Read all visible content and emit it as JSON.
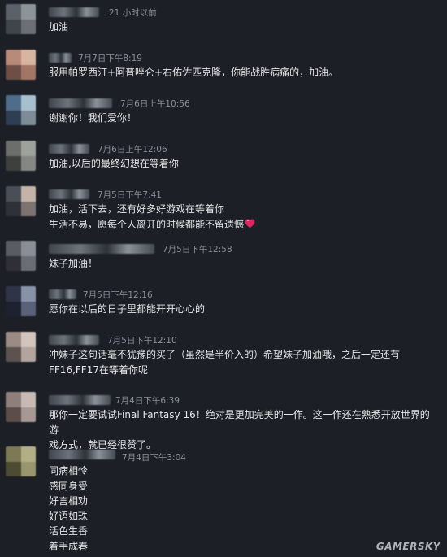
{
  "comments": [
    {
      "time": "21 小时以前",
      "text": "加油",
      "avatar": [
        "#5b6168",
        "#8d9499",
        "#3f454b",
        "#6c7076"
      ]
    },
    {
      "time": "7月7日下午8:19",
      "text": "服用帕罗西汀+阿普唑仑+右佑佐匹克隆，你能战胜病痛的，加油。",
      "avatar": [
        "#b88a7a",
        "#d8b4a3",
        "#6e4e45",
        "#a27567"
      ]
    },
    {
      "time": "7月6日上午10:56",
      "text": "谢谢你！我们爱你！",
      "avatar": [
        "#4d6d8a",
        "#a8bfd0",
        "#2f3e52",
        "#7d8c97"
      ]
    },
    {
      "time": "7月6日上午12:06",
      "text": "加油,以后的最终幻想在等着你",
      "avatar": [
        "#6b6e6a",
        "#9da29c",
        "#3e403f",
        "#848783"
      ]
    },
    {
      "time": "7月5日下午7:41",
      "text": "加油，活下去，还有好多好游戏在等着你\n生活不易，愿每个人离开的时候都能不留遗憾",
      "avatar": [
        "#4a4f57",
        "#c4b3a6",
        "#2e3137",
        "#7d7471"
      ]
    },
    {
      "time": "7月5日下午12:58",
      "text": "妹子加油！",
      "avatar": [
        "#5a5c63",
        "#8a8e96",
        "#2e3036",
        "#6b6e75"
      ]
    },
    {
      "time": "7月5日下午12:16",
      "text": "愿你在以后的日子里都能开开心心的",
      "avatar": [
        "#2f3547",
        "#8792a8",
        "#1e2230",
        "#5a627a"
      ]
    },
    {
      "time": "7月5日下午12:10",
      "text": "冲妹子这句话毫不犹豫的买了（虽然是半价入的）希望妹子加油哦，之后一定还有\nFF16,FF17在等着你呢",
      "avatar": [
        "#9a8c85",
        "#d1c5be",
        "#5c5350",
        "#b3a49d"
      ]
    },
    {
      "time": "7月4日下午6:39",
      "text": "那你一定要试试Final Fantasy 16！绝对是更加完美的一作。这一作还在熟悉开放世界的游\n戏方式，就已经很赞了。",
      "avatar": [
        "#8f7f7a",
        "#c8b9b3",
        "#5a4d4a",
        "#a89894"
      ]
    },
    {
      "time": "7月4日下午3:04",
      "text": "同病相怜\n感同身受\n好言相劝\n好语如珠\n活色生香\n着手成春",
      "avatar": [
        "#7c7a55",
        "#b2ae86",
        "#4d4b32",
        "#99956e"
      ]
    }
  ],
  "watermark": "GAMERSKY"
}
